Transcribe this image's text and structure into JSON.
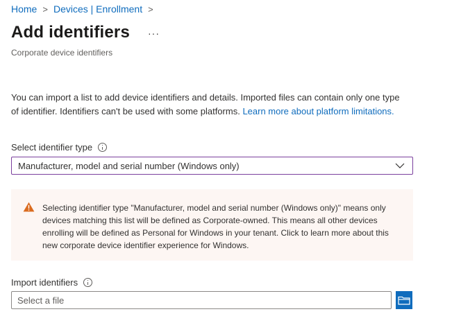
{
  "breadcrumb": {
    "items": [
      {
        "label": "Home"
      },
      {
        "label": "Devices | Enrollment"
      }
    ],
    "separator": ">"
  },
  "header": {
    "title": "Add identifiers",
    "more_label": "···",
    "subtitle": "Corporate device identifiers"
  },
  "description": {
    "text": "You can import a list to add device identifiers and details. Imported files can contain only one type of identifier. Identifiers can't be used with some platforms. ",
    "link": "Learn more about platform limitations."
  },
  "identifier_type": {
    "label": "Select identifier type",
    "selected": "Manufacturer, model and serial number (Windows only)"
  },
  "warning": {
    "text": "Selecting identifier type \"Manufacturer, model and serial number (Windows only)\" means only devices matching this list will be defined as Corporate-owned. This means all other devices enrolling will be defined as Personal for Windows in your tenant. Click to learn more about this new corporate device identifier experience for Windows."
  },
  "import": {
    "label": "Import identifiers",
    "placeholder": "Select a file",
    "value": ""
  },
  "colors": {
    "accent": "#0f6cbd",
    "focus_border": "#7a3e9d",
    "warning_bg": "#fdf6f3",
    "warning_icon": "#da6b1f"
  },
  "icons": {
    "breadcrumb_separator": "chevron-right-icon",
    "info": "info-icon",
    "dropdown": "chevron-down-icon",
    "warning": "warning-icon",
    "browse": "folder-icon"
  }
}
